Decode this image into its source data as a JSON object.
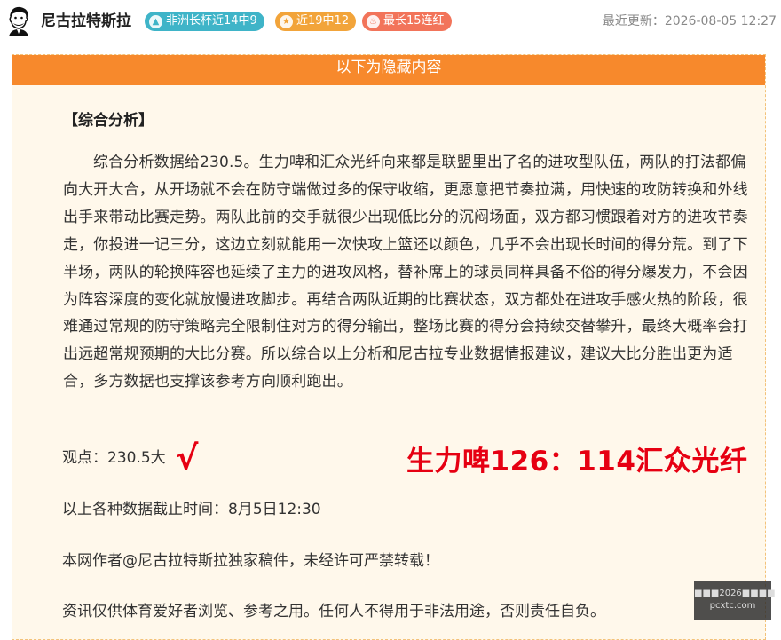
{
  "header": {
    "author": "尼古拉特斯拉",
    "badges": [
      {
        "icon": "arrow-up-icon",
        "label": "非洲长杯近14中9",
        "color": "#3fb4c8"
      },
      {
        "icon": "star-icon",
        "label": "近19中12",
        "color": "#f2a43a"
      },
      {
        "icon": "flame-icon",
        "label": "最长15连红",
        "color": "#f2745a"
      }
    ],
    "updated": "最近更新：2026-08-05 12:27"
  },
  "article": {
    "banner": "以下为隐藏内容",
    "heading": "【综合分析】",
    "paragraph": "综合分析数据给230.5。生力啤和汇众光纤向来都是联盟里出了名的进攻型队伍，两队的打法都偏向大开大合，从开场就不会在防守端做过多的保守收缩，更愿意把节奏拉满，用快速的攻防转换和外线出手来带动比赛走势。两队此前的交手就很少出现低比分的沉闷场面，双方都习惯跟着对方的进攻节奏走，你投进一记三分，这边立刻就能用一次快攻上篮还以颜色，几乎不会出现长时间的得分荒。到了下半场，两队的轮换阵容也延续了主力的进攻风格，替补席上的球员同样具备不俗的得分爆发力，不会因为阵容深度的变化就放慢进攻脚步。再结合两队近期的比赛状态，双方都处在进攻手感火热的阶段，很难通过常规的防守策略完全限制住对方的得分输出，整场比赛的得分会持续交替攀升，最终大概率会打出远超常规预期的大比分赛。所以综合以上分析和尼古拉专业数据情报建议，建议大比分胜出更为适合，多方数据也支撑该参考方向顺利跑出。",
    "view": "观点：230.5大",
    "check": "√",
    "score": "生力啤126：114汇众光纤",
    "cutoff": "以上各种数据截止时间：8月5日12:30",
    "copyright": "本网作者@尼古拉特斯拉独家稿件，未经许可严禁转载！",
    "disclaimer": "资讯仅供体育爱好者浏览、参考之用。任何人不得用于非法用途，否则责任自负。"
  },
  "watermark": {
    "line1": "■■■2026■■■■",
    "line2": "pcxtc.com"
  }
}
